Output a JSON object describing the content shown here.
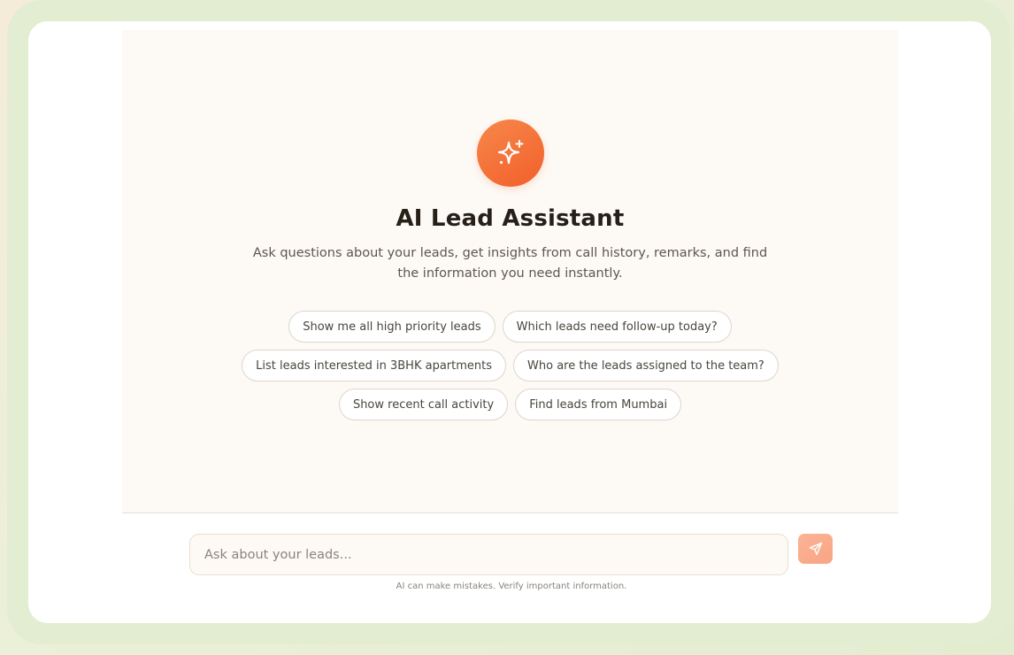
{
  "hero": {
    "icon": "sparkles-icon",
    "title": "AI Lead Assistant",
    "subtitle": "Ask questions about your leads, get insights from call history, remarks, and find the information you need instantly."
  },
  "suggestions": [
    [
      "Show me all high priority leads",
      "Which leads need follow-up today?"
    ],
    [
      "List leads interested in 3BHK apartments",
      "Who are the leads assigned to the team?"
    ],
    [
      "Show recent call activity",
      "Find leads from Mumbai"
    ]
  ],
  "composer": {
    "placeholder": "Ask about your leads...",
    "value": "",
    "send_icon": "send-icon",
    "disclaimer": "AI can make mistakes. Verify important information."
  },
  "colors": {
    "accent": "#f26a35",
    "accent_light": "#f9ad8c",
    "chat_background": "#fdf9f4",
    "page_background": "#e3edd1"
  }
}
